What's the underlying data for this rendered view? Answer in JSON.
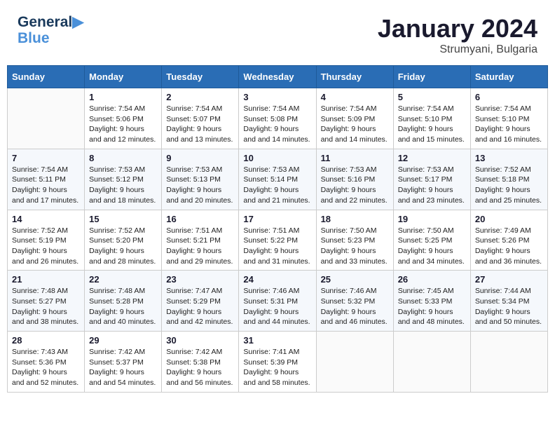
{
  "header": {
    "logo_line1": "General",
    "logo_line2": "Blue",
    "month": "January 2024",
    "location": "Strumyani, Bulgaria"
  },
  "weekdays": [
    "Sunday",
    "Monday",
    "Tuesday",
    "Wednesday",
    "Thursday",
    "Friday",
    "Saturday"
  ],
  "weeks": [
    [
      {
        "day": "",
        "sunrise": "",
        "sunset": "",
        "daylight": ""
      },
      {
        "day": "1",
        "sunrise": "Sunrise: 7:54 AM",
        "sunset": "Sunset: 5:06 PM",
        "daylight": "Daylight: 9 hours and 12 minutes."
      },
      {
        "day": "2",
        "sunrise": "Sunrise: 7:54 AM",
        "sunset": "Sunset: 5:07 PM",
        "daylight": "Daylight: 9 hours and 13 minutes."
      },
      {
        "day": "3",
        "sunrise": "Sunrise: 7:54 AM",
        "sunset": "Sunset: 5:08 PM",
        "daylight": "Daylight: 9 hours and 14 minutes."
      },
      {
        "day": "4",
        "sunrise": "Sunrise: 7:54 AM",
        "sunset": "Sunset: 5:09 PM",
        "daylight": "Daylight: 9 hours and 14 minutes."
      },
      {
        "day": "5",
        "sunrise": "Sunrise: 7:54 AM",
        "sunset": "Sunset: 5:10 PM",
        "daylight": "Daylight: 9 hours and 15 minutes."
      },
      {
        "day": "6",
        "sunrise": "Sunrise: 7:54 AM",
        "sunset": "Sunset: 5:10 PM",
        "daylight": "Daylight: 9 hours and 16 minutes."
      }
    ],
    [
      {
        "day": "7",
        "sunrise": "Sunrise: 7:54 AM",
        "sunset": "Sunset: 5:11 PM",
        "daylight": "Daylight: 9 hours and 17 minutes."
      },
      {
        "day": "8",
        "sunrise": "Sunrise: 7:53 AM",
        "sunset": "Sunset: 5:12 PM",
        "daylight": "Daylight: 9 hours and 18 minutes."
      },
      {
        "day": "9",
        "sunrise": "Sunrise: 7:53 AM",
        "sunset": "Sunset: 5:13 PM",
        "daylight": "Daylight: 9 hours and 20 minutes."
      },
      {
        "day": "10",
        "sunrise": "Sunrise: 7:53 AM",
        "sunset": "Sunset: 5:14 PM",
        "daylight": "Daylight: 9 hours and 21 minutes."
      },
      {
        "day": "11",
        "sunrise": "Sunrise: 7:53 AM",
        "sunset": "Sunset: 5:16 PM",
        "daylight": "Daylight: 9 hours and 22 minutes."
      },
      {
        "day": "12",
        "sunrise": "Sunrise: 7:53 AM",
        "sunset": "Sunset: 5:17 PM",
        "daylight": "Daylight: 9 hours and 23 minutes."
      },
      {
        "day": "13",
        "sunrise": "Sunrise: 7:52 AM",
        "sunset": "Sunset: 5:18 PM",
        "daylight": "Daylight: 9 hours and 25 minutes."
      }
    ],
    [
      {
        "day": "14",
        "sunrise": "Sunrise: 7:52 AM",
        "sunset": "Sunset: 5:19 PM",
        "daylight": "Daylight: 9 hours and 26 minutes."
      },
      {
        "day": "15",
        "sunrise": "Sunrise: 7:52 AM",
        "sunset": "Sunset: 5:20 PM",
        "daylight": "Daylight: 9 hours and 28 minutes."
      },
      {
        "day": "16",
        "sunrise": "Sunrise: 7:51 AM",
        "sunset": "Sunset: 5:21 PM",
        "daylight": "Daylight: 9 hours and 29 minutes."
      },
      {
        "day": "17",
        "sunrise": "Sunrise: 7:51 AM",
        "sunset": "Sunset: 5:22 PM",
        "daylight": "Daylight: 9 hours and 31 minutes."
      },
      {
        "day": "18",
        "sunrise": "Sunrise: 7:50 AM",
        "sunset": "Sunset: 5:23 PM",
        "daylight": "Daylight: 9 hours and 33 minutes."
      },
      {
        "day": "19",
        "sunrise": "Sunrise: 7:50 AM",
        "sunset": "Sunset: 5:25 PM",
        "daylight": "Daylight: 9 hours and 34 minutes."
      },
      {
        "day": "20",
        "sunrise": "Sunrise: 7:49 AM",
        "sunset": "Sunset: 5:26 PM",
        "daylight": "Daylight: 9 hours and 36 minutes."
      }
    ],
    [
      {
        "day": "21",
        "sunrise": "Sunrise: 7:48 AM",
        "sunset": "Sunset: 5:27 PM",
        "daylight": "Daylight: 9 hours and 38 minutes."
      },
      {
        "day": "22",
        "sunrise": "Sunrise: 7:48 AM",
        "sunset": "Sunset: 5:28 PM",
        "daylight": "Daylight: 9 hours and 40 minutes."
      },
      {
        "day": "23",
        "sunrise": "Sunrise: 7:47 AM",
        "sunset": "Sunset: 5:29 PM",
        "daylight": "Daylight: 9 hours and 42 minutes."
      },
      {
        "day": "24",
        "sunrise": "Sunrise: 7:46 AM",
        "sunset": "Sunset: 5:31 PM",
        "daylight": "Daylight: 9 hours and 44 minutes."
      },
      {
        "day": "25",
        "sunrise": "Sunrise: 7:46 AM",
        "sunset": "Sunset: 5:32 PM",
        "daylight": "Daylight: 9 hours and 46 minutes."
      },
      {
        "day": "26",
        "sunrise": "Sunrise: 7:45 AM",
        "sunset": "Sunset: 5:33 PM",
        "daylight": "Daylight: 9 hours and 48 minutes."
      },
      {
        "day": "27",
        "sunrise": "Sunrise: 7:44 AM",
        "sunset": "Sunset: 5:34 PM",
        "daylight": "Daylight: 9 hours and 50 minutes."
      }
    ],
    [
      {
        "day": "28",
        "sunrise": "Sunrise: 7:43 AM",
        "sunset": "Sunset: 5:36 PM",
        "daylight": "Daylight: 9 hours and 52 minutes."
      },
      {
        "day": "29",
        "sunrise": "Sunrise: 7:42 AM",
        "sunset": "Sunset: 5:37 PM",
        "daylight": "Daylight: 9 hours and 54 minutes."
      },
      {
        "day": "30",
        "sunrise": "Sunrise: 7:42 AM",
        "sunset": "Sunset: 5:38 PM",
        "daylight": "Daylight: 9 hours and 56 minutes."
      },
      {
        "day": "31",
        "sunrise": "Sunrise: 7:41 AM",
        "sunset": "Sunset: 5:39 PM",
        "daylight": "Daylight: 9 hours and 58 minutes."
      },
      {
        "day": "",
        "sunrise": "",
        "sunset": "",
        "daylight": ""
      },
      {
        "day": "",
        "sunrise": "",
        "sunset": "",
        "daylight": ""
      },
      {
        "day": "",
        "sunrise": "",
        "sunset": "",
        "daylight": ""
      }
    ]
  ]
}
